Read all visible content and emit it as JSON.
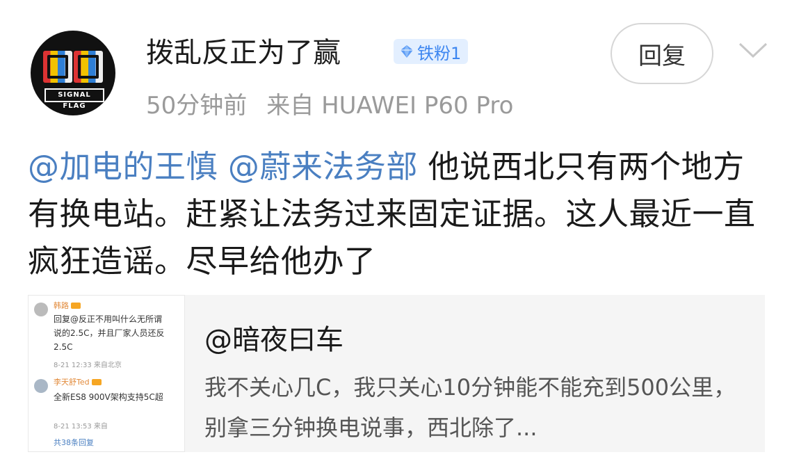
{
  "post": {
    "username": "拨乱反正为了赢",
    "badge": {
      "icon": "diamond-icon",
      "label": "铁粉1",
      "color": "#3d86f0"
    },
    "time": "50分钟前",
    "source": "来自 HUAWEI P60 Pro",
    "reply_label": "回复",
    "mention1": "@加电的王慎",
    "mention2": "@蔚来法务部",
    "text": " 他说西北只有两个地方有换电站。赶紧让法务过来固定证据。这人最近一直疯狂造谣。尽早给他办了"
  },
  "quote": {
    "title": "@暗夜曰车",
    "body": "我不关心几C，我只关心10分钟能不能充到500公里，别拿三分钟换电说事，西北除了...",
    "thumbnail": {
      "c1_name": "韩路",
      "c1_text1": "回复@反正不用叫什么无所谓",
      "c1_text2": "说的2.5C，并且厂家人员还反",
      "c1_text3": "2.5C",
      "c1_time": "8-21 12:33 来自北京",
      "c2_name": "李天舒Ted",
      "c2_text1": "全新ES8 900V架构支持5C超",
      "c2_time": "8-21 13:53 来自",
      "more": "共38条回复"
    }
  },
  "watermark": "",
  "colors": {
    "mention": "#4a7fc1",
    "meta": "#9a9a9a"
  }
}
